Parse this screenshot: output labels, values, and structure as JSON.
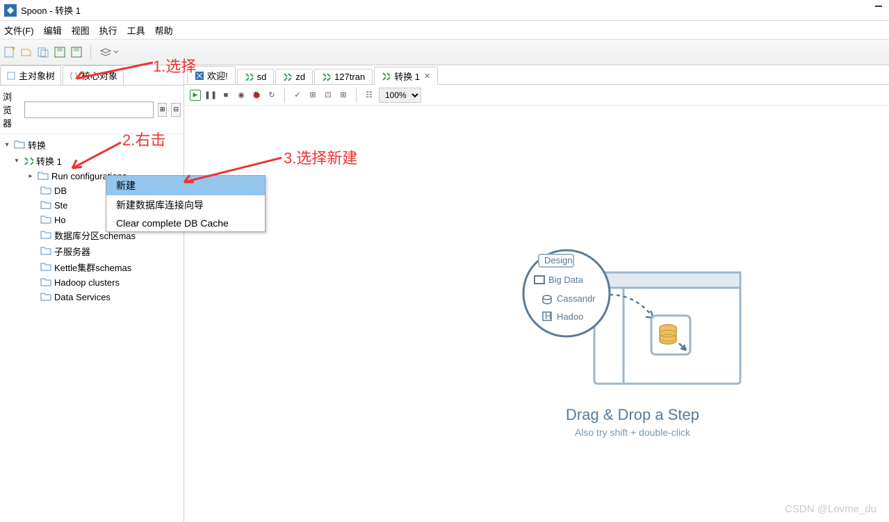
{
  "window": {
    "title": "Spoon - 转换 1"
  },
  "menu": {
    "file": "文件(F)",
    "edit": "编辑",
    "view": "视图",
    "run": "执行",
    "tools": "工具",
    "help": "帮助"
  },
  "leftTabs": {
    "tree": "主对象树",
    "core": "核心对象"
  },
  "browser": {
    "label": "浏览器",
    "placeholder": ""
  },
  "treeNodes": {
    "root": "转换",
    "trans1": "转换 1",
    "runConfig": "Run configurations",
    "db": "DB",
    "ste": "Ste",
    "ho": "Ho",
    "partition": "数据库分区schemas",
    "slave": "子服务器",
    "cluster": "Kettle集群schemas",
    "hadoop": "Hadoop clusters",
    "dataServices": "Data Services"
  },
  "tabs": {
    "welcome": "欢迎!",
    "sd": "sd",
    "zd": "zd",
    "tran127": "127tran",
    "trans1": "转换 1"
  },
  "canvasBar": {
    "zoom": "100%"
  },
  "context": {
    "newItem": "新建",
    "wizard": "新建数据库连接向导",
    "clearCache": "Clear complete DB Cache"
  },
  "illu": {
    "designTab": "Design",
    "bigData": "Big Data",
    "cassandra": "Cassandr",
    "hadoop": "Hadoo",
    "title": "Drag & Drop a Step",
    "subtitle": "Also try shift + double-click"
  },
  "annotations": {
    "a1": "1.选择",
    "a2": "2.右击",
    "a3": "3.选择新建"
  },
  "watermark": "CSDN @Lovme_du"
}
